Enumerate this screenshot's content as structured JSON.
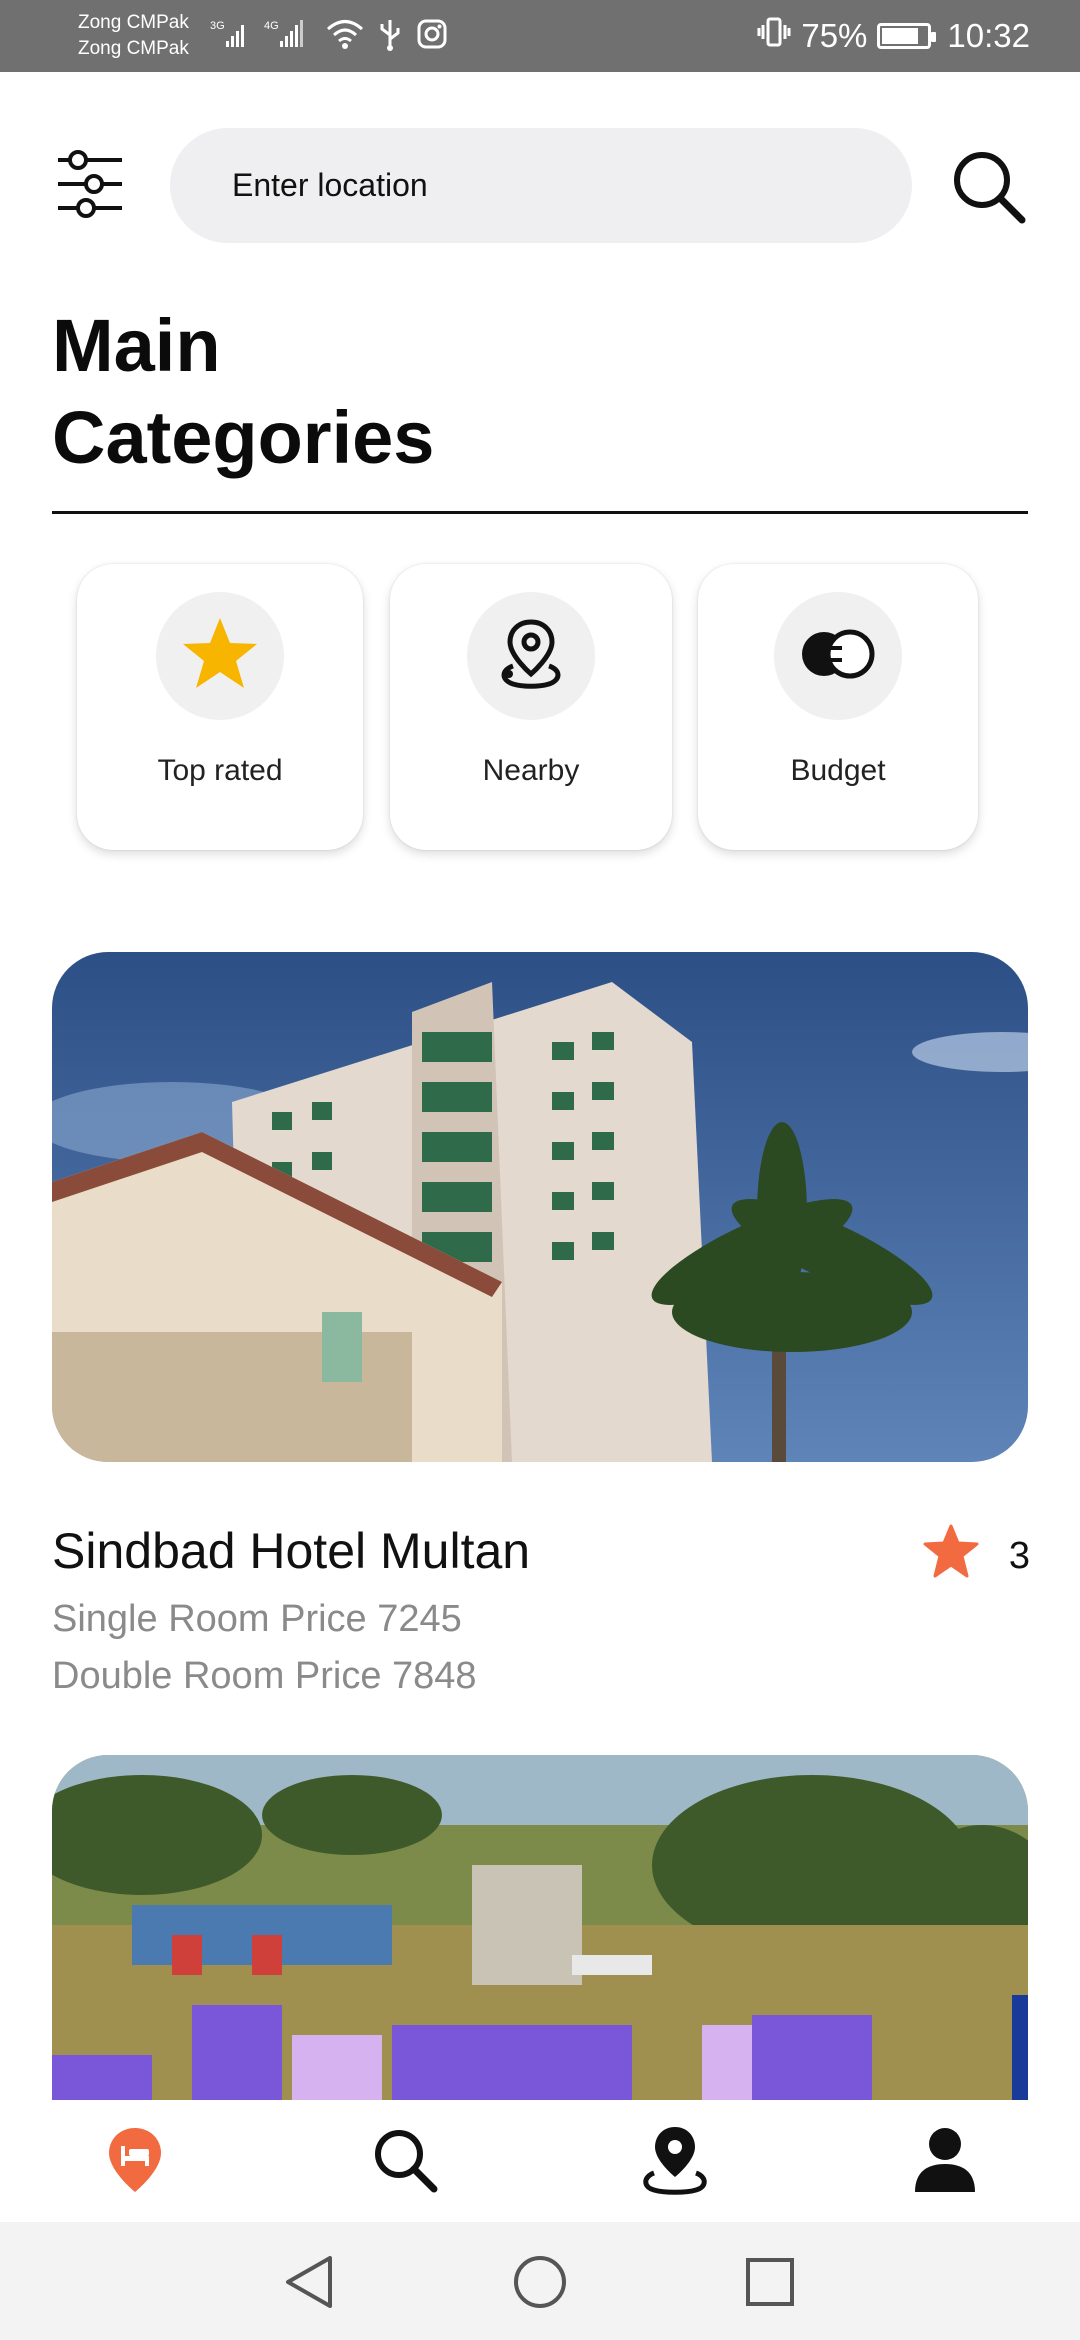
{
  "status_bar": {
    "carrier_1": "Zong CMPak",
    "carrier_2": "Zong CMPak",
    "network_1": "3G",
    "network_2": "4G",
    "battery": "75%",
    "battery_level": 0.75,
    "time": "10:32"
  },
  "header": {
    "search_placeholder": "Enter location",
    "filter_icon": "sliders-icon",
    "search_icon": "search-icon"
  },
  "section": {
    "title_line1": "Main",
    "title_line2": "Categories"
  },
  "categories": [
    {
      "label": "Top rated",
      "icon": "star-icon"
    },
    {
      "label": "Nearby",
      "icon": "map-pin-icon"
    },
    {
      "label": "Budget",
      "icon": "coins-icon"
    }
  ],
  "hotels": [
    {
      "name": "Sindbad Hotel Multan",
      "rating": "3",
      "single_price": "Single Room Price 7245",
      "double_price": "Double Room Price 7848"
    }
  ],
  "bottom_nav": [
    {
      "name": "hotels-tab",
      "icon": "bed-pin-icon",
      "active": true
    },
    {
      "name": "search-tab",
      "icon": "search-icon",
      "active": false
    },
    {
      "name": "map-tab",
      "icon": "location-icon",
      "active": false
    },
    {
      "name": "profile-tab",
      "icon": "user-icon",
      "active": false
    }
  ],
  "colors": {
    "accent": "#f26a3f",
    "star_gold": "#f7b500",
    "search_bg": "#efeff1",
    "muted_text": "#8a8a8a",
    "status_bar": "#707070"
  }
}
